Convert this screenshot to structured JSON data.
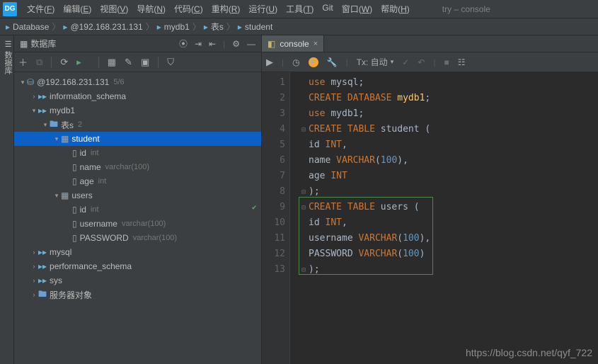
{
  "app": {
    "logo": "DG",
    "title": "try – console"
  },
  "menu": [
    {
      "label": "文件",
      "mn": "F"
    },
    {
      "label": "编辑",
      "mn": "E"
    },
    {
      "label": "视图",
      "mn": "V"
    },
    {
      "label": "导航",
      "mn": "N"
    },
    {
      "label": "代码",
      "mn": "C"
    },
    {
      "label": "重构",
      "mn": "R"
    },
    {
      "label": "运行",
      "mn": "U"
    },
    {
      "label": "工具",
      "mn": "T"
    },
    {
      "label": "Git",
      "mn": ""
    },
    {
      "label": "窗口",
      "mn": "W"
    },
    {
      "label": "帮助",
      "mn": "H"
    }
  ],
  "breadcrumb": [
    {
      "icon": "schema",
      "label": "Database"
    },
    {
      "icon": "db",
      "label": "@192.168.231.131"
    },
    {
      "icon": "schema",
      "label": "mydb1"
    },
    {
      "icon": "folder",
      "label": "表s"
    },
    {
      "icon": "table",
      "label": "student"
    }
  ],
  "panel": {
    "title": "数据库",
    "rail": "数据库"
  },
  "tree": {
    "root": {
      "label": "@192.168.231.131",
      "meta": "5/6"
    },
    "schemas": [
      {
        "label": "information_schema"
      },
      {
        "label": "mydb1",
        "expanded": true,
        "folder": {
          "label": "表s",
          "meta": "2"
        },
        "tables": [
          {
            "label": "student",
            "selected": true,
            "cols": [
              {
                "name": "id",
                "type": "int"
              },
              {
                "name": "name",
                "type": "varchar(100)"
              },
              {
                "name": "age",
                "type": "int"
              }
            ]
          },
          {
            "label": "users",
            "cols": [
              {
                "name": "id",
                "type": "int"
              },
              {
                "name": "username",
                "type": "varchar(100)"
              },
              {
                "name": "PASSWORD",
                "type": "varchar(100)"
              }
            ]
          }
        ]
      },
      {
        "label": "mysql"
      },
      {
        "label": "performance_schema"
      },
      {
        "label": "sys"
      }
    ],
    "server_objects": "服务器对象"
  },
  "tab": {
    "label": "console"
  },
  "editor": {
    "tx_label": "Tx: 自动",
    "lines": [
      [
        {
          "t": "use ",
          "c": "kw"
        },
        {
          "t": "mysql",
          "c": "id"
        },
        {
          "t": ";",
          "c": "pn"
        }
      ],
      [
        {
          "t": "CREATE DATABASE ",
          "c": "kw"
        },
        {
          "t": "mydb1",
          "c": "tn"
        },
        {
          "t": ";",
          "c": "pn"
        }
      ],
      [
        {
          "t": "use ",
          "c": "kw"
        },
        {
          "t": "mydb1",
          "c": "id"
        },
        {
          "t": ";",
          "c": "pn"
        }
      ],
      [
        {
          "t": "CREATE TABLE ",
          "c": "kw"
        },
        {
          "t": "student",
          "c": "id"
        },
        {
          "t": " (",
          "c": "pn"
        }
      ],
      [
        {
          "t": "id ",
          "c": "id"
        },
        {
          "t": "INT",
          "c": "kw"
        },
        {
          "t": ",",
          "c": "pn"
        }
      ],
      [
        {
          "t": "name ",
          "c": "id"
        },
        {
          "t": "VARCHAR",
          "c": "kw"
        },
        {
          "t": "(",
          "c": "pn"
        },
        {
          "t": "100",
          "c": "num"
        },
        {
          "t": ")",
          "c": "pn"
        },
        {
          "t": ",",
          "c": "pn"
        }
      ],
      [
        {
          "t": "age ",
          "c": "id"
        },
        {
          "t": "INT",
          "c": "kw"
        }
      ],
      [
        {
          "t": ")",
          "c": "pn"
        },
        {
          "t": ";",
          "c": "pn"
        }
      ],
      [
        {
          "t": "CREATE TABLE ",
          "c": "kw"
        },
        {
          "t": "users",
          "c": "id"
        },
        {
          "t": " (",
          "c": "pn"
        }
      ],
      [
        {
          "t": "id ",
          "c": "id"
        },
        {
          "t": "INT",
          "c": "kw"
        },
        {
          "t": ",",
          "c": "pn"
        }
      ],
      [
        {
          "t": "username ",
          "c": "id"
        },
        {
          "t": "VARCHAR",
          "c": "kw"
        },
        {
          "t": "(",
          "c": "pn"
        },
        {
          "t": "100",
          "c": "num"
        },
        {
          "t": ")",
          "c": "pn"
        },
        {
          "t": ",",
          "c": "pn"
        }
      ],
      [
        {
          "t": "PASSWORD ",
          "c": "id"
        },
        {
          "t": "VARCHAR",
          "c": "kw"
        },
        {
          "t": "(",
          "c": "pn"
        },
        {
          "t": "100",
          "c": "num"
        },
        {
          "t": ")",
          "c": "pn"
        }
      ],
      [
        {
          "t": ")",
          "c": "pn"
        },
        {
          "t": ";",
          "c": "pn"
        }
      ]
    ],
    "fold_at": [
      4,
      8,
      9,
      13
    ],
    "check_at": 9
  },
  "watermark": "https://blog.csdn.net/qyf_722"
}
